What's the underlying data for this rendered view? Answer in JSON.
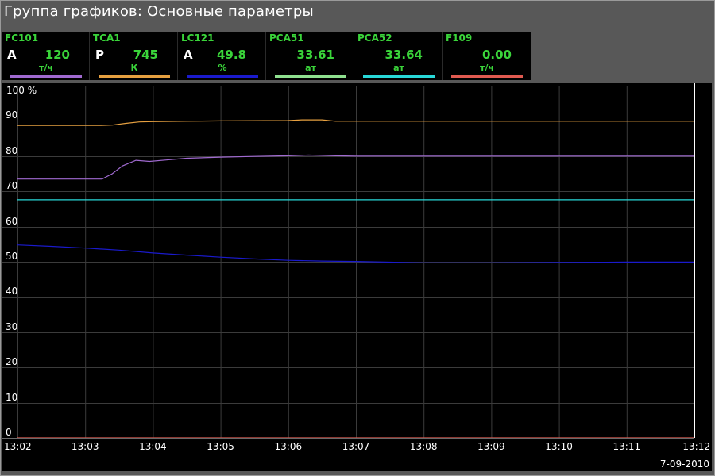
{
  "window": {
    "title": "Группа графиков: Основные параметры"
  },
  "tags": [
    {
      "name": "FC101",
      "mode": "A",
      "value": "120",
      "unit": "т/ч",
      "color": "#a06ad0"
    },
    {
      "name": "TCA1",
      "mode": "P",
      "value": "745",
      "unit": "К",
      "color": "#e6a040"
    },
    {
      "name": "LC121",
      "mode": "A",
      "value": "49.8",
      "unit": "%",
      "color": "#1a1acd"
    },
    {
      "name": "PCA51",
      "mode": "",
      "value": "33.61",
      "unit": "ат",
      "color": "#8fe08f"
    },
    {
      "name": "PCA52",
      "mode": "",
      "value": "33.64",
      "unit": "ат",
      "color": "#28d8d8"
    },
    {
      "name": "F109",
      "mode": "",
      "value": "0.00",
      "unit": "т/ч",
      "color": "#e05a50"
    }
  ],
  "chart_data": {
    "type": "line",
    "background": "#000000",
    "grid": true,
    "ylim": [
      0,
      100
    ],
    "y_ticks": [
      10,
      20,
      30,
      40,
      50,
      60,
      70,
      80,
      90
    ],
    "y_top_label": "100 %",
    "y_zero_label": "0",
    "x_ticks": [
      "13:02",
      "13:03",
      "13:04",
      "13:05",
      "13:06",
      "13:07",
      "13:08",
      "13:09",
      "13:10",
      "13:11",
      "13:12"
    ],
    "xlim_min": [
      0,
      10
    ],
    "date": "7-09-2010",
    "series": [
      {
        "tag": "TCA1",
        "color": "#e6a040",
        "x": [
          0,
          1.2,
          1.4,
          1.6,
          1.8,
          2.0,
          2.5,
          3.0,
          4.0,
          4.2,
          4.5,
          4.7,
          5.0,
          6.0,
          7.0,
          8.0,
          9.0,
          10.0
        ],
        "y": [
          88.7,
          88.7,
          88.8,
          89.3,
          89.7,
          89.8,
          89.9,
          90.0,
          90.1,
          90.3,
          90.3,
          89.9,
          89.9,
          89.9,
          89.9,
          89.9,
          89.9,
          89.9
        ]
      },
      {
        "tag": "FC101",
        "color": "#a06ad0",
        "x": [
          0,
          1.25,
          1.4,
          1.55,
          1.75,
          1.95,
          2.2,
          2.5,
          3.0,
          3.5,
          4.0,
          4.3,
          4.7,
          5.0,
          6.0,
          7.0,
          8.0,
          9.0,
          10.0
        ],
        "y": [
          73.5,
          73.5,
          75.0,
          77.2,
          78.8,
          78.5,
          78.9,
          79.4,
          79.7,
          79.9,
          80.1,
          80.3,
          80.1,
          80.0,
          80.0,
          80.0,
          80.0,
          80.0,
          80.0
        ]
      },
      {
        "tag": "PCA52",
        "color": "#28d8d8",
        "x": [
          0,
          10
        ],
        "y": [
          67.6,
          67.6
        ]
      },
      {
        "tag": "LC121",
        "color": "#1a1acd",
        "x": [
          0,
          0.5,
          1.0,
          1.5,
          2.0,
          2.5,
          3.0,
          3.5,
          4.0,
          4.5,
          5.0,
          6.0,
          7.0,
          8.0,
          9.0,
          10.0
        ],
        "y": [
          54.8,
          54.4,
          53.9,
          53.3,
          52.5,
          51.9,
          51.3,
          50.8,
          50.4,
          50.2,
          50.1,
          49.7,
          49.7,
          49.8,
          49.9,
          49.9
        ]
      },
      {
        "tag": "F109",
        "color": "#e05a50",
        "x": [
          0,
          10
        ],
        "y": [
          0,
          0
        ]
      }
    ]
  }
}
